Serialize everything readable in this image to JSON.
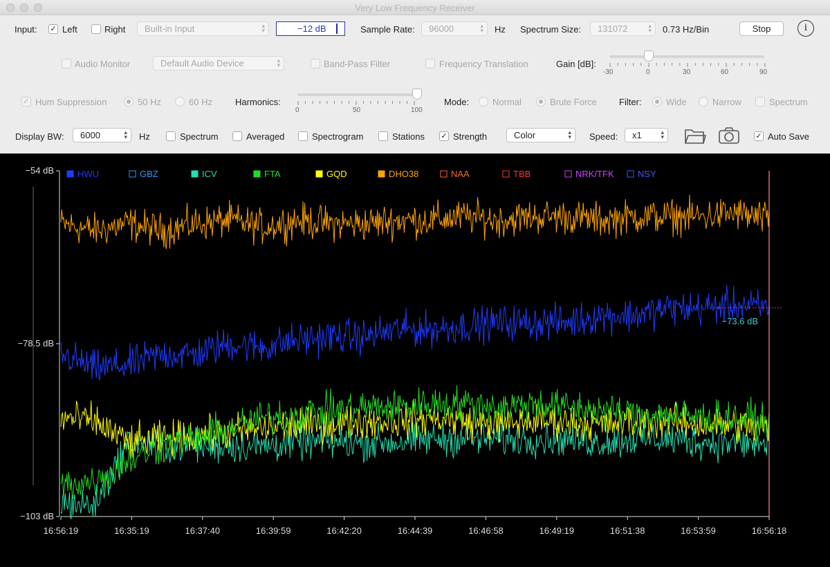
{
  "window": {
    "title": "Very Low Frequency Receiver"
  },
  "row1": {
    "input_label": "Input:",
    "left_label": "Left",
    "left_checked": true,
    "right_label": "Right",
    "right_checked": false,
    "device_value": "Built-in Input",
    "level_value": "−12 dB",
    "sample_rate_label": "Sample Rate:",
    "sample_rate_value": "96000",
    "sample_rate_unit": "Hz",
    "spectrum_size_label": "Spectrum Size:",
    "spectrum_size_value": "131072",
    "bin_resolution": "0.73 Hz/Bin",
    "stop_label": "Stop",
    "info_icon": "i"
  },
  "row2": {
    "audio_monitor_label": "Audio Monitor",
    "audio_device_value": "Default Audio Device",
    "bandpass_label": "Band-Pass Filter",
    "freq_translation_label": "Frequency Translation",
    "gain_label": "Gain [dB]:",
    "gain_value": 0,
    "gain_ticks": [
      "-30",
      "0",
      "30",
      "60",
      "90"
    ]
  },
  "row3": {
    "hum_label": "Hum Suppression",
    "hum_50": "50 Hz",
    "hum_60": "60 Hz",
    "harmonics_label": "Harmonics:",
    "harmonics_value": 100,
    "harmonics_ticks": [
      "0",
      "50",
      "100"
    ],
    "mode_label": "Mode:",
    "mode_normal": "Normal",
    "mode_brute": "Brute Force",
    "filter_label": "Filter:",
    "filter_wide": "Wide",
    "filter_narrow": "Narrow",
    "filter_spectrum": "Spectrum"
  },
  "row4": {
    "display_bw_label": "Display BW:",
    "display_bw_value": "6000",
    "display_bw_unit": "Hz",
    "spectrum_label": "Spectrum",
    "spectrum_checked": false,
    "averaged_label": "Averaged",
    "averaged_checked": false,
    "spectrogram_label": "Spectrogram",
    "spectrogram_checked": false,
    "stations_label": "Stations",
    "stations_checked": false,
    "strength_label": "Strength",
    "strength_checked": true,
    "color_value": "Color",
    "speed_label": "Speed:",
    "speed_value": "x1",
    "auto_save_label": "Auto Save",
    "auto_save_checked": true
  },
  "colors": {
    "HWU": "#1e3cff",
    "GBZ": "#3399ff",
    "ICV": "#22e0b0",
    "FTA": "#22dd22",
    "GQD": "#ffff00",
    "DHO38": "#ffa500",
    "NAA": "#ff6633",
    "TBB": "#ff3333",
    "NRK/TFK": "#cc44ff",
    "NSY": "#4455ff",
    "cursor_readout": "#33cccc",
    "marker": "#ff3333"
  },
  "chart_data": {
    "type": "line",
    "title": "",
    "y_tick_labels": [
      "−54 dB",
      "−78.5 dB",
      "−103 dB"
    ],
    "ylim": [
      -103,
      -54
    ],
    "x_tick_labels": [
      "16:56:19",
      "16:35:19",
      "16:37:40",
      "16:39:59",
      "16:42:20",
      "16:44:39",
      "16:46:58",
      "16:49:19",
      "16:51:38",
      "16:53:59",
      "16:56:18"
    ],
    "legend": [
      {
        "name": "HWU",
        "filled": true
      },
      {
        "name": "GBZ",
        "filled": false
      },
      {
        "name": "ICV",
        "filled": true
      },
      {
        "name": "FTA",
        "filled": true
      },
      {
        "name": "GQD",
        "filled": true
      },
      {
        "name": "DHO38",
        "filled": true
      },
      {
        "name": "NAA",
        "filled": false
      },
      {
        "name": "TBB",
        "filled": false
      },
      {
        "name": "NRK/TFK",
        "filled": false
      },
      {
        "name": "NSY",
        "filled": false
      }
    ],
    "cursor_readout": "−73.6 dB",
    "cursor_value": -73.6,
    "series": [
      {
        "name": "DHO38",
        "values": [
          -61.5,
          -62.5,
          -61.5,
          -62.5,
          -61.5,
          -61,
          -62,
          -61,
          -61.5,
          -61.5,
          -61,
          -61,
          -60.5,
          -61,
          -60.5,
          -60.5,
          -61,
          -60.5,
          -60.5,
          -60.5,
          -60,
          -61
        ]
      },
      {
        "name": "HWU",
        "values": [
          -80,
          -82,
          -81.5,
          -80,
          -80,
          -78.5,
          -79,
          -78,
          -77.5,
          -77.5,
          -76.5,
          -76.5,
          -76,
          -75.5,
          -75.5,
          -75.5,
          -74.5,
          -74.5,
          -73.5,
          -73.5,
          -73,
          -73.5
        ]
      },
      {
        "name": "FTA",
        "values": [
          -98.5,
          -98,
          -95,
          -93,
          -92,
          -90.5,
          -89,
          -88.5,
          -88,
          -87.5,
          -87.5,
          -87,
          -87,
          -87.5,
          -87,
          -87.5,
          -88,
          -88.5,
          -88.5,
          -89,
          -89,
          -89.5
        ]
      },
      {
        "name": "GQD",
        "values": [
          -89,
          -89.5,
          -92.5,
          -92,
          -91.5,
          -91,
          -90.5,
          -90,
          -90,
          -89.5,
          -89.5,
          -89,
          -89.5,
          -90,
          -89.5,
          -89.5,
          -90,
          -89.5,
          -89.5,
          -90,
          -90,
          -90.5
        ]
      },
      {
        "name": "ICV",
        "values": [
          -101,
          -101.5,
          -92.5,
          -93,
          -93,
          -93,
          -93,
          -92.5,
          -92.5,
          -92.5,
          -92.5,
          -92,
          -92,
          -92,
          -92,
          -92,
          -92.5,
          -92,
          -92,
          -92.5,
          -92.5,
          -93
        ]
      }
    ]
  }
}
